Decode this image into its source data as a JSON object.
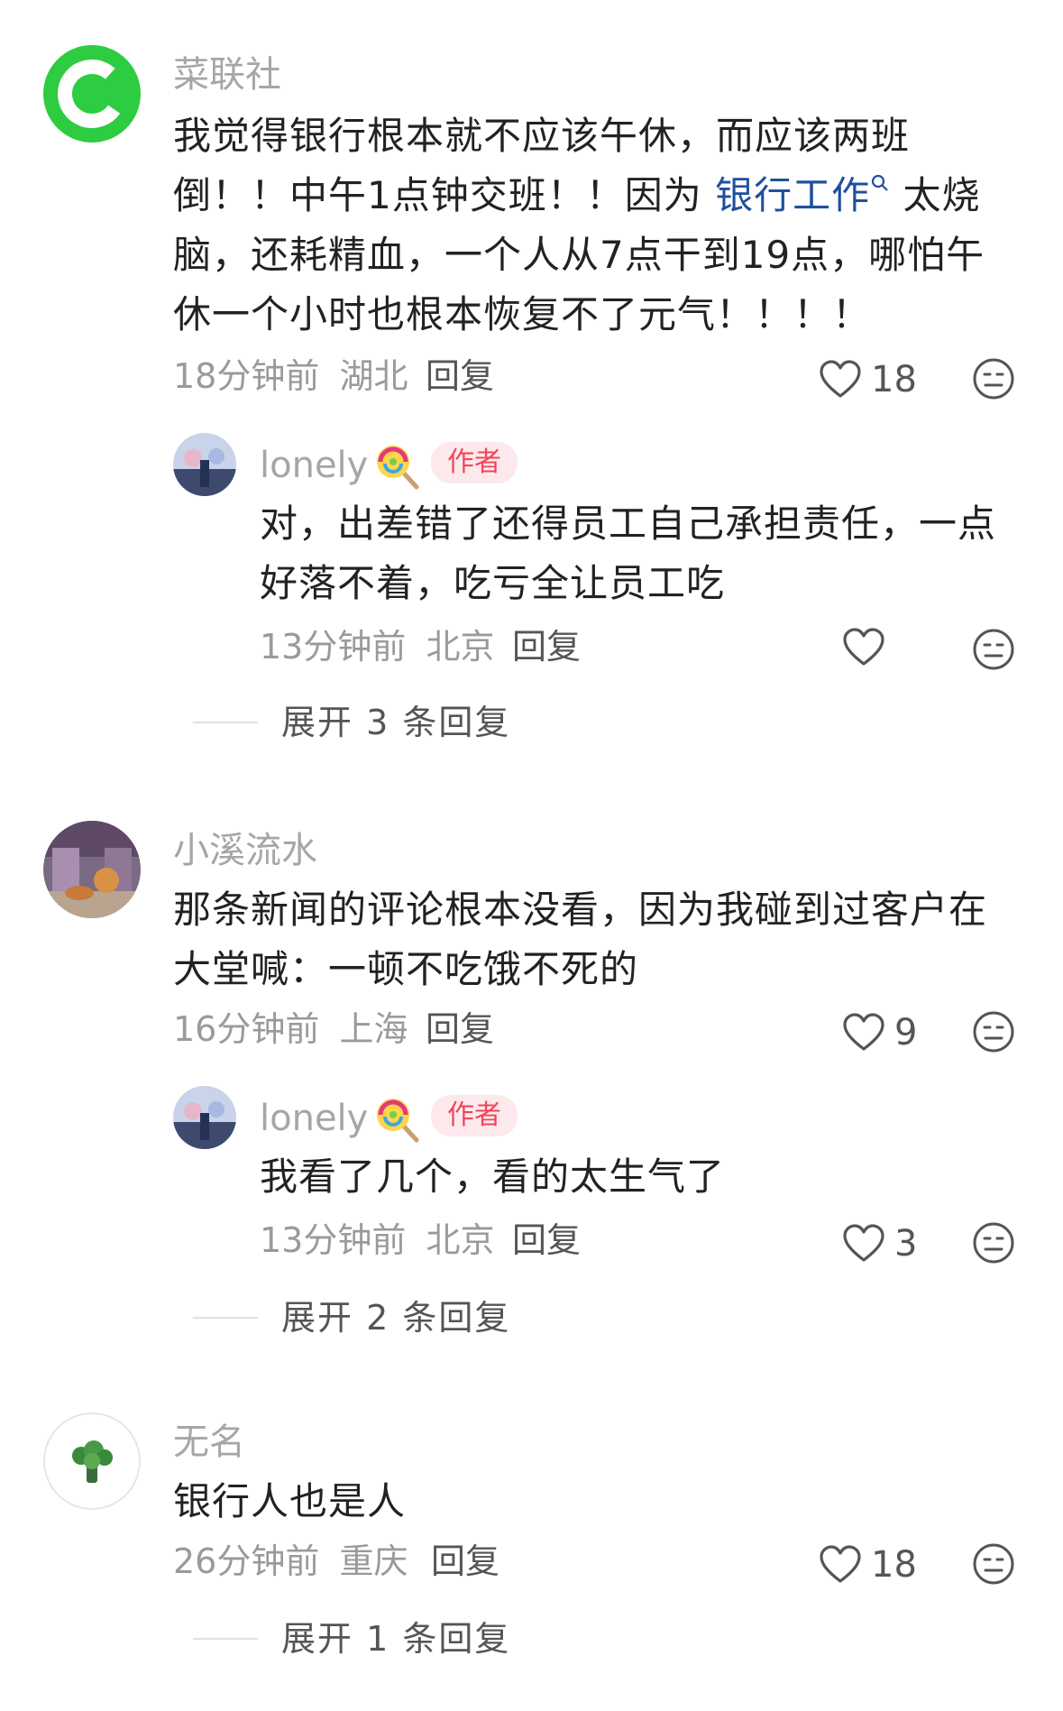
{
  "comments": [
    {
      "username": "菜联社",
      "text_before": "我觉得银行根本就不应该午休，而应该两班倒！！中午1点钟交班！！因为",
      "link": "银行工作",
      "text_after": "太烧脑，还耗精血，一个人从7点干到19点，哪怕午休一个小时也根本恢复不了元气！！！！",
      "time": "18分钟前",
      "location": "湖北",
      "reply_label": "回复",
      "likes": "18",
      "replies": [
        {
          "username": "lonely",
          "badge": "作者",
          "text": "对，出差错了还得员工自己承担责任，一点好落不着，吃亏全让员工吃",
          "time": "13分钟前",
          "location": "北京",
          "reply_label": "回复",
          "likes": ""
        }
      ],
      "expand_label": "展开 3 条回复"
    },
    {
      "username": "小溪流水",
      "text": "那条新闻的评论根本没看，因为我碰到过客户在大堂喊：一顿不吃饿不死的",
      "time": "16分钟前",
      "location": "上海",
      "reply_label": "回复",
      "likes": "9",
      "replies": [
        {
          "username": "lonely",
          "badge": "作者",
          "text": "我看了几个，看的太生气了",
          "time": "13分钟前",
          "location": "北京",
          "reply_label": "回复",
          "likes": "3"
        }
      ],
      "expand_label": "展开 2 条回复"
    },
    {
      "username": "无名",
      "text": "银行人也是人",
      "time": "26分钟前",
      "location": "重庆",
      "reply_label": "回复",
      "likes": "18",
      "expand_label": "展开 1 条回复"
    }
  ],
  "colors": {
    "link": "#1f4f9f",
    "badge_bg": "#fde9ec",
    "badge_text": "#f0455a",
    "logo_green": "#2ecc40"
  },
  "icons": [
    "heart-icon",
    "meh-face-icon",
    "search-icon",
    "lollipop-icon",
    "broccoli-icon"
  ]
}
